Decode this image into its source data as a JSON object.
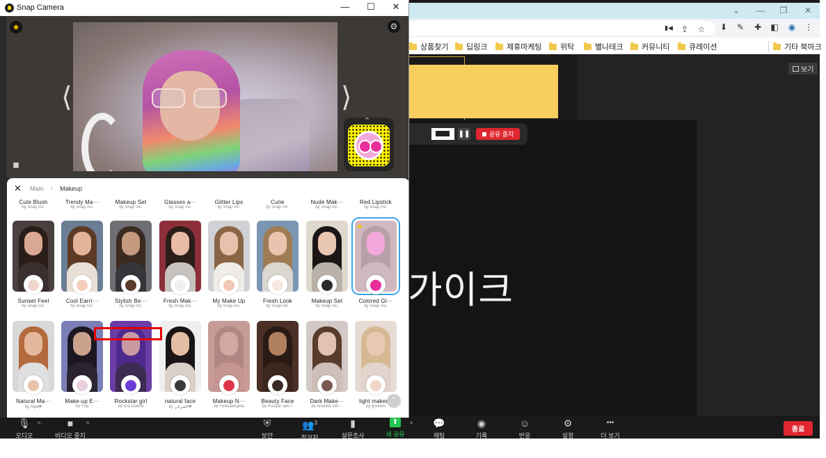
{
  "snap": {
    "title": "Snap Camera",
    "controls": {
      "minimize": "—",
      "maximize": "☐",
      "close": "✕"
    },
    "preview": {
      "left_arrow": "⟨",
      "right_arrow": "⟩",
      "favorite_glyph": "★",
      "settings_glyph": "⚙",
      "camera_glyph": "◙",
      "snapcode_up": "⌃"
    },
    "breadcrumb": {
      "close": "✕",
      "root": "Main",
      "separator": "›",
      "current": "Makeup"
    },
    "top_row": [
      {
        "name": "Cute Blush",
        "by": "by Snap Inc."
      },
      {
        "name": "Trendy Ma···",
        "by": "by Snap Inc."
      },
      {
        "name": "Makeup Set",
        "by": "by Snap Inc."
      },
      {
        "name": "Glasses a···",
        "by": "by Snap Inc."
      },
      {
        "name": "Glitter Lips",
        "by": "by Snap Inc."
      },
      {
        "name": "Cutie",
        "by": "by Snap Inc."
      },
      {
        "name": "Nude Mak···",
        "by": "by Snap Inc."
      },
      {
        "name": "Red Lipstick",
        "by": "by Snap Inc."
      }
    ],
    "row1": [
      {
        "name": "Sunset Feel",
        "by": "by Snap Inc.",
        "bg": "#4a4040",
        "skin": "#d9a893",
        "hair": "#2a1d18",
        "body": "#3b3030",
        "av": "#f1d5cd"
      },
      {
        "name": "Cool Earri···",
        "by": "by Snap Inc.",
        "bg": "#6b7e95",
        "skin": "#e3b49a",
        "hair": "#5c3a25",
        "body": "#e8e0d6",
        "av": "#f4cdbd"
      },
      {
        "name": "Stylish Be···",
        "by": "by Snap Inc.",
        "bg": "#6e6f74",
        "skin": "#c49b7e",
        "hair": "#3b2a20",
        "body": "#35363a",
        "av": "#5a3b2a"
      },
      {
        "name": "Fresh Mak···",
        "by": "by Snap Inc.",
        "bg": "#8c2f3a",
        "skin": "#e7bba6",
        "hair": "#2b1d18",
        "body": "#c9c3bf",
        "av": "#efefef"
      },
      {
        "name": "My Make Up",
        "by": "by Snap Inc.",
        "bg": "#cfd1d4",
        "skin": "#e6c1ac",
        "hair": "#8a6545",
        "body": "#f0ede8",
        "av": "#f2c6b5"
      },
      {
        "name": "Fresh Look",
        "by": "by Snap Inc.",
        "bg": "#7b96b3",
        "skin": "#e8c3ae",
        "hair": "#a07c55",
        "body": "#dad6d0",
        "av": "#f7e8e2"
      },
      {
        "name": "Makeup Set",
        "by": "by Snap Inc.",
        "bg": "#ded8cf",
        "skin": "#e9c6b0",
        "hair": "#1c1515",
        "body": "#b9b2a9",
        "av": "#2b2b2b"
      },
      {
        "name": "Colored Gl···",
        "by": "by Snap Inc.",
        "bg": "#cfb8c0",
        "skin": "#f2a8da",
        "hair": "#b8a0a8",
        "body": "#cfb8c0",
        "av": "#e62f9a"
      }
    ],
    "row2": [
      {
        "name": "Natural Ma···",
        "by": "by Alya❤",
        "bg": "#d8d8d8",
        "skin": "#e4b89c",
        "hair": "#b36a3c",
        "body": "#e0e0e0",
        "av": "#e8c3a8"
      },
      {
        "name": "Make-up E···",
        "by": "by Yug",
        "bg": "#7a7fb8",
        "skin": "#caa18b",
        "hair": "#1c1720",
        "body": "#2a2530",
        "av": "#ead0dc"
      },
      {
        "name": "Rockstar girl",
        "by": "by Iiza Duarte",
        "bg": "#6a3ea5",
        "skin": "#c99aa2",
        "hair": "#4e2a8f",
        "body": "#3d2b52",
        "av": "#6a3bd6"
      },
      {
        "name": "natural face",
        "by": "by الشرقي❤",
        "bg": "#efefef",
        "skin": "#e4bda5",
        "hair": "#1a1414",
        "body": "#d9d0c9",
        "av": "#3a3a3a"
      },
      {
        "name": "Makeup N···",
        "by": "by Feliciaangela",
        "bg": "#c79c97",
        "skin": "#d4a8a2",
        "hair": "#b08783",
        "body": "#c49591",
        "av": "#e0344b"
      },
      {
        "name": "Beauty Face",
        "by": "by Ruzgar spe☺",
        "bg": "#4b3026",
        "skin": "#b07f60",
        "hair": "#2a1a14",
        "body": "#3d2820",
        "av": "#3a2a25"
      },
      {
        "name": "Dark Make···",
        "by": "by Ananda Per···",
        "bg": "#d2c9c6",
        "skin": "#e3c2b2",
        "hair": "#5a3c2d",
        "body": "#cdbfb8",
        "av": "#7a5a50"
      },
      {
        "name": "light makeup",
        "by": "by gorkem",
        "bg": "#e6dbd5",
        "skin": "#e9c9b5",
        "hair": "#d6b993",
        "body": "#e2d4cc",
        "av": "#efd6c6"
      }
    ],
    "scroll_top_glyph": "⌃"
  },
  "browser": {
    "window_controls": [
      "⌄",
      "—",
      "❐",
      "✕"
    ],
    "addr_icons": [
      "▮◀",
      "⇪",
      "☆",
      "⬇",
      "✎",
      "✚",
      "◧",
      "◉",
      "⋮"
    ],
    "bookmarks": [
      "상품찾기",
      "딥링크",
      "제휴마케팅",
      "위탁",
      "별나테크",
      "커뮤니티",
      "큐레이션"
    ],
    "other_bookmarks": "기타 북마크"
  },
  "zoom": {
    "big_text": "가이크",
    "view_button": "보기",
    "share_bar": {
      "pause": "❚❚",
      "stop_label": "공유 중지"
    },
    "toolbar": [
      {
        "key": "audio",
        "icon": "🎙",
        "label": "오디오"
      },
      {
        "key": "video",
        "icon": "■",
        "label": "비디오 중지"
      },
      {
        "key": "security",
        "icon": "⛨",
        "label": "보안"
      },
      {
        "key": "participants",
        "icon": "👥",
        "label": "참가자"
      },
      {
        "key": "polls",
        "icon": "▮",
        "label": "설문조사"
      },
      {
        "key": "new-share",
        "icon": "⬆",
        "label": "새 공유"
      },
      {
        "key": "chat",
        "icon": "💬",
        "label": "채팅"
      },
      {
        "key": "record",
        "icon": "◉",
        "label": "기록"
      },
      {
        "key": "reactions",
        "icon": "☺",
        "label": "반응"
      },
      {
        "key": "settings",
        "icon": "⚙",
        "label": "설정"
      },
      {
        "key": "more",
        "icon": "•••",
        "label": "더 보기"
      }
    ],
    "participants_count": "3",
    "end_button": "종료"
  }
}
